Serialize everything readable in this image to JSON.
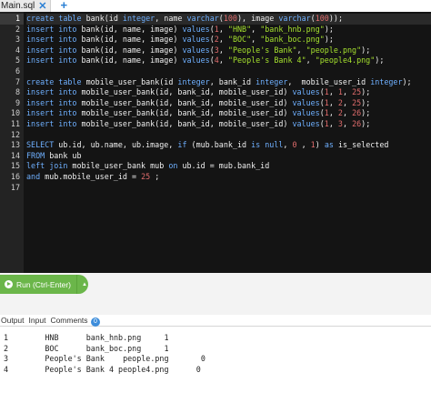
{
  "tabs": [
    {
      "label": "Main.sql",
      "close_icon": "close-icon"
    }
  ],
  "add_tab_icon": "plus-icon",
  "editor": {
    "line_numbers": [
      "1",
      "2",
      "3",
      "4",
      "5",
      "6",
      "7",
      "8",
      "9",
      "10",
      "11",
      "12",
      "13",
      "14",
      "15",
      "16",
      "17"
    ],
    "active_line": 1,
    "lines": [
      [
        {
          "t": "create table ",
          "c": "kw"
        },
        {
          "t": "bank(id ",
          "c": ""
        },
        {
          "t": "integer",
          "c": "kw"
        },
        {
          "t": ", name ",
          "c": ""
        },
        {
          "t": "varchar",
          "c": "kw"
        },
        {
          "t": "(",
          "c": ""
        },
        {
          "t": "100",
          "c": "num"
        },
        {
          "t": "), image ",
          "c": ""
        },
        {
          "t": "varchar",
          "c": "kw"
        },
        {
          "t": "(",
          "c": ""
        },
        {
          "t": "100",
          "c": "num"
        },
        {
          "t": "));",
          "c": ""
        }
      ],
      [
        {
          "t": "insert into ",
          "c": "kw"
        },
        {
          "t": "bank(id, name, image) ",
          "c": ""
        },
        {
          "t": "values",
          "c": "kw"
        },
        {
          "t": "(",
          "c": ""
        },
        {
          "t": "1",
          "c": "num"
        },
        {
          "t": ", ",
          "c": ""
        },
        {
          "t": "\"HNB\"",
          "c": "str"
        },
        {
          "t": ", ",
          "c": ""
        },
        {
          "t": "\"bank_hnb.png\"",
          "c": "str"
        },
        {
          "t": ");",
          "c": ""
        }
      ],
      [
        {
          "t": "insert into ",
          "c": "kw"
        },
        {
          "t": "bank(id, name, image) ",
          "c": ""
        },
        {
          "t": "values",
          "c": "kw"
        },
        {
          "t": "(",
          "c": ""
        },
        {
          "t": "2",
          "c": "num"
        },
        {
          "t": ", ",
          "c": ""
        },
        {
          "t": "\"BOC\"",
          "c": "str"
        },
        {
          "t": ", ",
          "c": ""
        },
        {
          "t": "\"bank_boc.png\"",
          "c": "str"
        },
        {
          "t": ");",
          "c": ""
        }
      ],
      [
        {
          "t": "insert into ",
          "c": "kw"
        },
        {
          "t": "bank(id, name, image) ",
          "c": ""
        },
        {
          "t": "values",
          "c": "kw"
        },
        {
          "t": "(",
          "c": ""
        },
        {
          "t": "3",
          "c": "num"
        },
        {
          "t": ", ",
          "c": ""
        },
        {
          "t": "\"People's Bank\"",
          "c": "str"
        },
        {
          "t": ", ",
          "c": ""
        },
        {
          "t": "\"people.png\"",
          "c": "str"
        },
        {
          "t": ");",
          "c": ""
        }
      ],
      [
        {
          "t": "insert into ",
          "c": "kw"
        },
        {
          "t": "bank(id, name, image) ",
          "c": ""
        },
        {
          "t": "values",
          "c": "kw"
        },
        {
          "t": "(",
          "c": ""
        },
        {
          "t": "4",
          "c": "num"
        },
        {
          "t": ", ",
          "c": ""
        },
        {
          "t": "\"People's Bank 4\"",
          "c": "str"
        },
        {
          "t": ", ",
          "c": ""
        },
        {
          "t": "\"people4.png\"",
          "c": "str"
        },
        {
          "t": ");",
          "c": ""
        }
      ],
      [],
      [
        {
          "t": "create table ",
          "c": "kw"
        },
        {
          "t": "mobile_user_bank(id ",
          "c": ""
        },
        {
          "t": "integer",
          "c": "kw"
        },
        {
          "t": ", bank_id ",
          "c": ""
        },
        {
          "t": "integer",
          "c": "kw"
        },
        {
          "t": ",  mobile_user_id ",
          "c": ""
        },
        {
          "t": "integer",
          "c": "kw"
        },
        {
          "t": ");",
          "c": ""
        }
      ],
      [
        {
          "t": "insert into ",
          "c": "kw"
        },
        {
          "t": "mobile_user_bank(id, bank_id, mobile_user_id) ",
          "c": ""
        },
        {
          "t": "values",
          "c": "kw"
        },
        {
          "t": "(",
          "c": ""
        },
        {
          "t": "1",
          "c": "num"
        },
        {
          "t": ", ",
          "c": ""
        },
        {
          "t": "1",
          "c": "num"
        },
        {
          "t": ", ",
          "c": ""
        },
        {
          "t": "25",
          "c": "num"
        },
        {
          "t": ");",
          "c": ""
        }
      ],
      [
        {
          "t": "insert into ",
          "c": "kw"
        },
        {
          "t": "mobile_user_bank(id, bank_id, mobile_user_id) ",
          "c": ""
        },
        {
          "t": "values",
          "c": "kw"
        },
        {
          "t": "(",
          "c": ""
        },
        {
          "t": "1",
          "c": "num"
        },
        {
          "t": ", ",
          "c": ""
        },
        {
          "t": "2",
          "c": "num"
        },
        {
          "t": ", ",
          "c": ""
        },
        {
          "t": "25",
          "c": "num"
        },
        {
          "t": ");",
          "c": ""
        }
      ],
      [
        {
          "t": "insert into ",
          "c": "kw"
        },
        {
          "t": "mobile_user_bank(id, bank_id, mobile_user_id) ",
          "c": ""
        },
        {
          "t": "values",
          "c": "kw"
        },
        {
          "t": "(",
          "c": ""
        },
        {
          "t": "1",
          "c": "num"
        },
        {
          "t": ", ",
          "c": ""
        },
        {
          "t": "2",
          "c": "num"
        },
        {
          "t": ", ",
          "c": ""
        },
        {
          "t": "26",
          "c": "num"
        },
        {
          "t": ");",
          "c": ""
        }
      ],
      [
        {
          "t": "insert into ",
          "c": "kw"
        },
        {
          "t": "mobile_user_bank(id, bank_id, mobile_user_id) ",
          "c": ""
        },
        {
          "t": "values",
          "c": "kw"
        },
        {
          "t": "(",
          "c": ""
        },
        {
          "t": "1",
          "c": "num"
        },
        {
          "t": ", ",
          "c": ""
        },
        {
          "t": "3",
          "c": "num"
        },
        {
          "t": ", ",
          "c": ""
        },
        {
          "t": "26",
          "c": "num"
        },
        {
          "t": ");",
          "c": ""
        }
      ],
      [],
      [
        {
          "t": "SELECT ",
          "c": "kw"
        },
        {
          "t": "ub.id, ub.name, ub.image, ",
          "c": ""
        },
        {
          "t": "if",
          "c": "kw"
        },
        {
          "t": " (mub.bank_id ",
          "c": ""
        },
        {
          "t": "is null",
          "c": "kw"
        },
        {
          "t": ", ",
          "c": ""
        },
        {
          "t": "0",
          "c": "num"
        },
        {
          "t": " , ",
          "c": ""
        },
        {
          "t": "1",
          "c": "num"
        },
        {
          "t": ") ",
          "c": ""
        },
        {
          "t": "as",
          "c": "kw"
        },
        {
          "t": " is_selected",
          "c": ""
        }
      ],
      [
        {
          "t": "FROM ",
          "c": "kw"
        },
        {
          "t": "bank ub",
          "c": ""
        }
      ],
      [
        {
          "t": "left join ",
          "c": "kw"
        },
        {
          "t": "mobile_user_bank mub ",
          "c": ""
        },
        {
          "t": "on ",
          "c": "kw"
        },
        {
          "t": "ub.id = mub.bank_id",
          "c": ""
        }
      ],
      [
        {
          "t": "and ",
          "c": "kw"
        },
        {
          "t": "mub.mobile_user_id = ",
          "c": ""
        },
        {
          "t": "25",
          "c": "num"
        },
        {
          "t": " ;",
          "c": ""
        }
      ],
      []
    ]
  },
  "run_button": {
    "label": "Run (Ctrl-Enter)",
    "icon": "play-circle-icon",
    "dropdown_icon": "caret-up-icon"
  },
  "output_tabs": {
    "output": "Output",
    "input": "Input",
    "comments": "Comments",
    "comments_count": "0"
  },
  "output_lines": [
    "1        HNB      bank_hnb.png     1",
    "2        BOC      bank_boc.png     1",
    "3        People's Bank    people.png       0",
    "4        People's Bank 4 people4.png      0"
  ],
  "colors": {
    "editor_bg": "#141414",
    "keyword": "#6fb0ff",
    "string": "#a6e22e",
    "number": "#e06c6c",
    "run_button": "#6bb64a",
    "badge": "#3d8ddb"
  }
}
